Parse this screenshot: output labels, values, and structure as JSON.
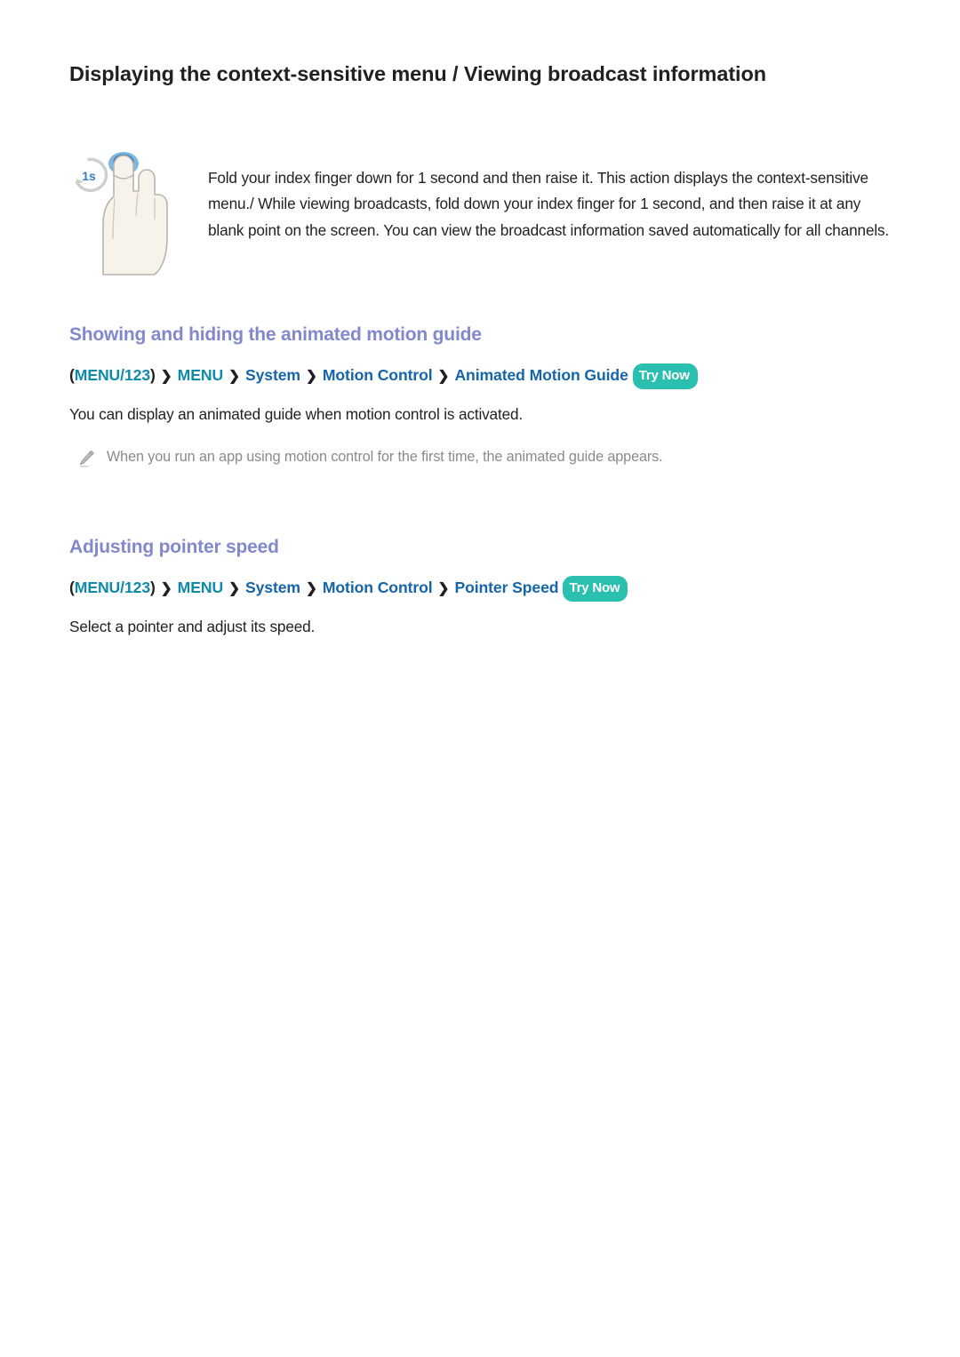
{
  "page": {
    "title": "Displaying the context-sensitive menu / Viewing broadcast information"
  },
  "intro": {
    "icon_name": "hand-index-finger-tap-1s",
    "timer_badge": "1s",
    "text": "Fold your index finger down for 1 second and then raise it. This action displays the context-sensitive menu./ While viewing broadcasts, fold down your index finger for 1 second, and then raise it at any blank point on the screen. You can view the broadcast information saved automatically for all channels."
  },
  "sections": [
    {
      "heading": "Showing and hiding the animated motion guide",
      "breadcrumb": {
        "open_paren": "(",
        "root": "MENU/123",
        "close_paren": ")",
        "separator": "❯",
        "items": [
          "MENU",
          "System",
          "Motion Control",
          "Animated Motion Guide"
        ],
        "badge": "Try Now"
      },
      "body": "You can display an animated guide when motion control is activated.",
      "note": {
        "icon_name": "pencil-note-icon",
        "text": "When you run an app using motion control for the first time, the animated guide appears."
      }
    },
    {
      "heading": "Adjusting pointer speed",
      "breadcrumb": {
        "open_paren": "(",
        "root": "MENU/123",
        "close_paren": ")",
        "separator": "❯",
        "items": [
          "MENU",
          "System",
          "Motion Control",
          "Pointer Speed"
        ],
        "badge": "Try Now"
      },
      "body": "Select a pointer and adjust its speed."
    }
  ],
  "colors": {
    "heading_purple": "#8189cc",
    "menu_teal": "#0f8aab",
    "item_blue": "#1565a8",
    "badge_teal": "#2bbfb0",
    "body_black": "#231f20",
    "note_grey": "#8a8a8a",
    "hand_fill": "#f7f3ea",
    "hand_stroke": "#b9b4ab",
    "marker_blue": "#2f7fc1"
  }
}
